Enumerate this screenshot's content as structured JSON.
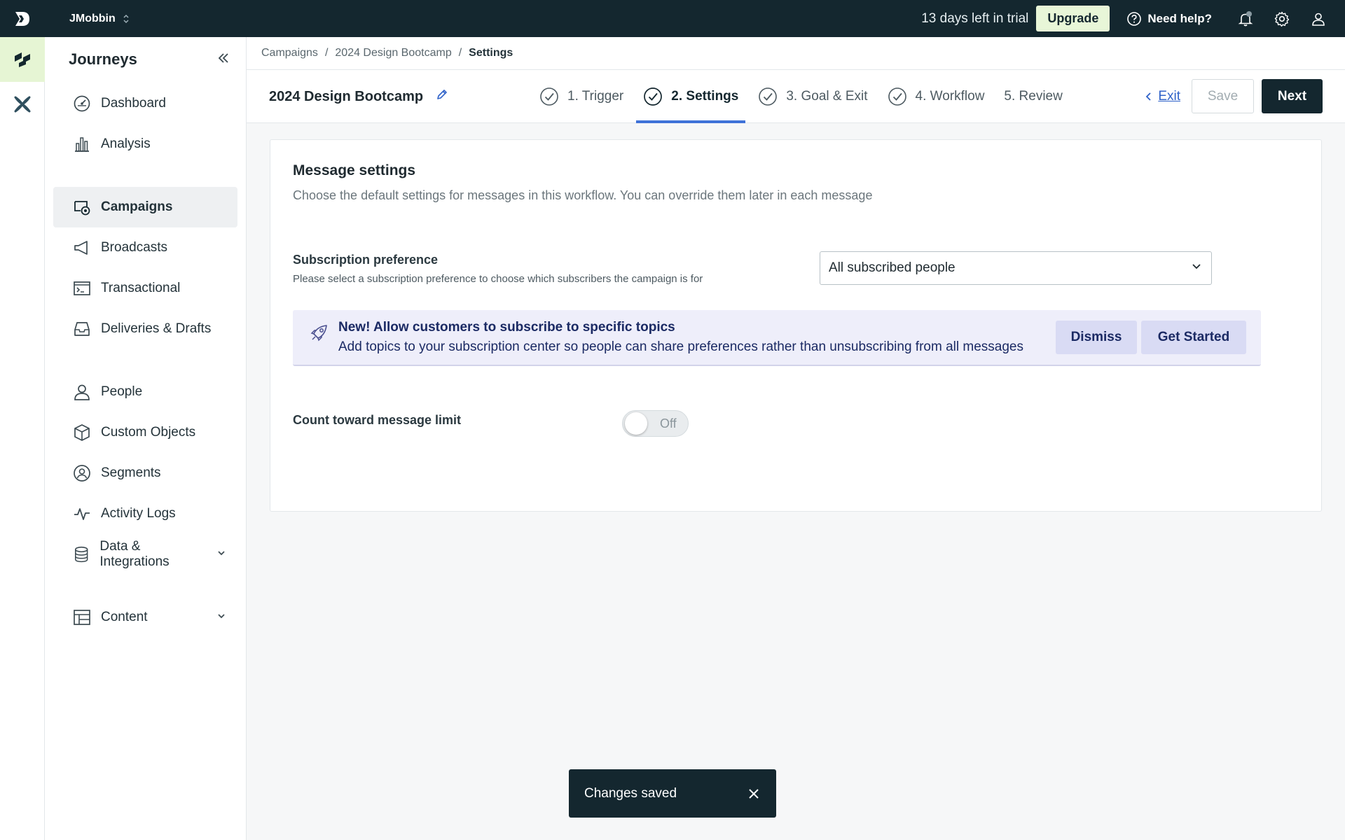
{
  "topbar": {
    "workspace": "JMobbin",
    "trial_text": "13 days left in trial",
    "upgrade_label": "Upgrade",
    "help_label": "Need help?"
  },
  "rail": {
    "items": [
      {
        "icon": "journeys-logo-icon",
        "active": true
      },
      {
        "icon": "x-product-icon",
        "active": false
      }
    ]
  },
  "sidebar": {
    "title": "Journeys",
    "items": [
      {
        "label": "Dashboard",
        "icon": "gauge-icon"
      },
      {
        "label": "Analysis",
        "icon": "bar-chart-icon"
      },
      {
        "label": "Campaigns",
        "icon": "campaign-icon",
        "active": true
      },
      {
        "label": "Broadcasts",
        "icon": "megaphone-icon"
      },
      {
        "label": "Transactional",
        "icon": "terminal-icon"
      },
      {
        "label": "Deliveries & Drafts",
        "icon": "inbox-icon"
      },
      {
        "label": "People",
        "icon": "person-icon"
      },
      {
        "label": "Custom Objects",
        "icon": "cube-icon"
      },
      {
        "label": "Segments",
        "icon": "segment-icon"
      },
      {
        "label": "Activity Logs",
        "icon": "activity-icon"
      },
      {
        "label": "Data & Integrations",
        "icon": "database-icon"
      },
      {
        "label": "Content",
        "icon": "layout-icon"
      }
    ]
  },
  "breadcrumb": {
    "items": [
      "Campaigns",
      "2024 Design Bootcamp",
      "Settings"
    ],
    "separator": "/"
  },
  "campaign": {
    "name": "2024 Design Bootcamp"
  },
  "steps": [
    {
      "label": "1. Trigger",
      "checked": true
    },
    {
      "label": "2. Settings",
      "checked": true,
      "active": true
    },
    {
      "label": "3. Goal & Exit",
      "checked": true
    },
    {
      "label": "4. Workflow",
      "checked": true
    },
    {
      "label": "5. Review",
      "checked": false
    }
  ],
  "actions": {
    "exit_label": "Exit",
    "save_label": "Save",
    "next_label": "Next"
  },
  "settings": {
    "title": "Message settings",
    "description": "Choose the default settings for messages in this workflow. You can override them later in each message",
    "subscription": {
      "label": "Subscription preference",
      "help": "Please select a subscription preference to choose which subscribers the campaign is for",
      "value": "All subscribed people"
    },
    "banner": {
      "title": "New! Allow customers to subscribe to specific topics",
      "text": "Add topics to your subscription center so people can share preferences rather than unsubscribing from all messages",
      "dismiss_label": "Dismiss",
      "start_label": "Get Started"
    },
    "message_limit": {
      "label": "Count toward message limit",
      "toggle_text": "Off"
    }
  },
  "toast": {
    "text": "Changes saved"
  },
  "colors": {
    "topbar": "#14272f",
    "accent": "#3f72d8",
    "rail_active": "#e6f5d4",
    "banner_bg": "#eeeefa"
  }
}
